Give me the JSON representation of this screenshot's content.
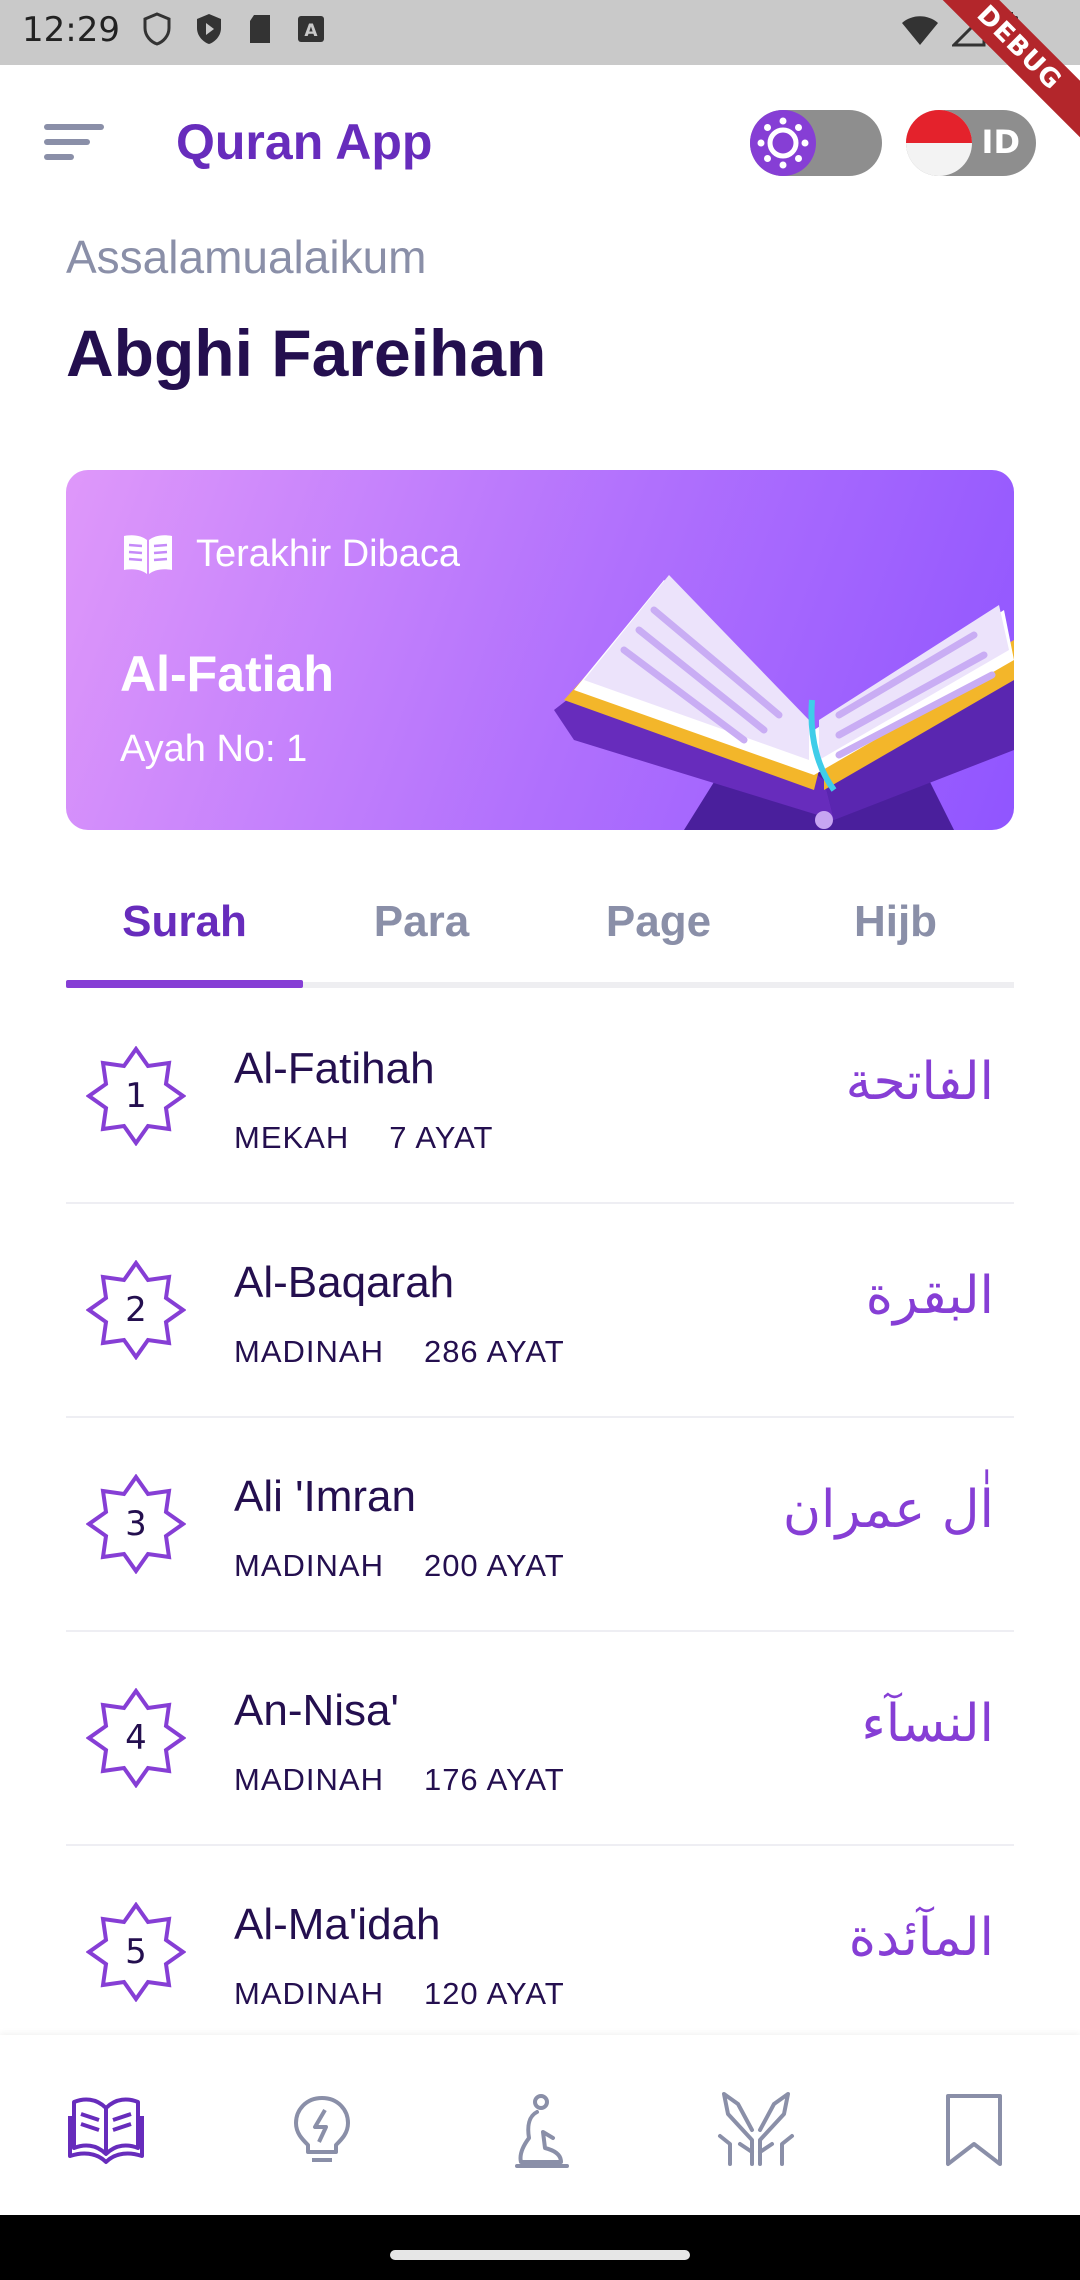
{
  "status_bar": {
    "time": "12:29",
    "debug_label": "DEBUG"
  },
  "app_bar": {
    "title": "Quran App",
    "language_code": "ID"
  },
  "greeting": "Assalamualaikum",
  "user_name": "Abghi Fareihan",
  "last_read": {
    "label": "Terakhir Dibaca",
    "surah": "Al-Fatiah",
    "ayah": "Ayah No: 1"
  },
  "tabs": [
    {
      "label": "Surah",
      "active": true
    },
    {
      "label": "Para",
      "active": false
    },
    {
      "label": "Page",
      "active": false
    },
    {
      "label": "Hijb",
      "active": false
    }
  ],
  "surahs": [
    {
      "number": "1",
      "name": "Al-Fatihah",
      "place": "MEKAH",
      "ayat": "7 AYAT",
      "arabic": "الفاتحة"
    },
    {
      "number": "2",
      "name": "Al-Baqarah",
      "place": "MADINAH",
      "ayat": "286 AYAT",
      "arabic": "البقرة"
    },
    {
      "number": "3",
      "name": "Ali 'Imran",
      "place": "MADINAH",
      "ayat": "200 AYAT",
      "arabic": "اٰل عمران"
    },
    {
      "number": "4",
      "name": "An-Nisa'",
      "place": "MADINAH",
      "ayat": "176 AYAT",
      "arabic": "النسآء"
    },
    {
      "number": "5",
      "name": "Al-Ma'idah",
      "place": "MADINAH",
      "ayat": "120 AYAT",
      "arabic": "المآئدة"
    }
  ],
  "bottom_nav": [
    {
      "icon": "quran-icon",
      "active": true
    },
    {
      "icon": "lamp-icon",
      "active": false
    },
    {
      "icon": "prayer-icon",
      "active": false
    },
    {
      "icon": "doa-hands-icon",
      "active": false
    },
    {
      "icon": "bookmark-icon",
      "active": false
    }
  ],
  "colors": {
    "primary": "#863ed5",
    "title": "#672cbc",
    "text_dark": "#240f4f",
    "text_muted": "#8a8fa8"
  }
}
